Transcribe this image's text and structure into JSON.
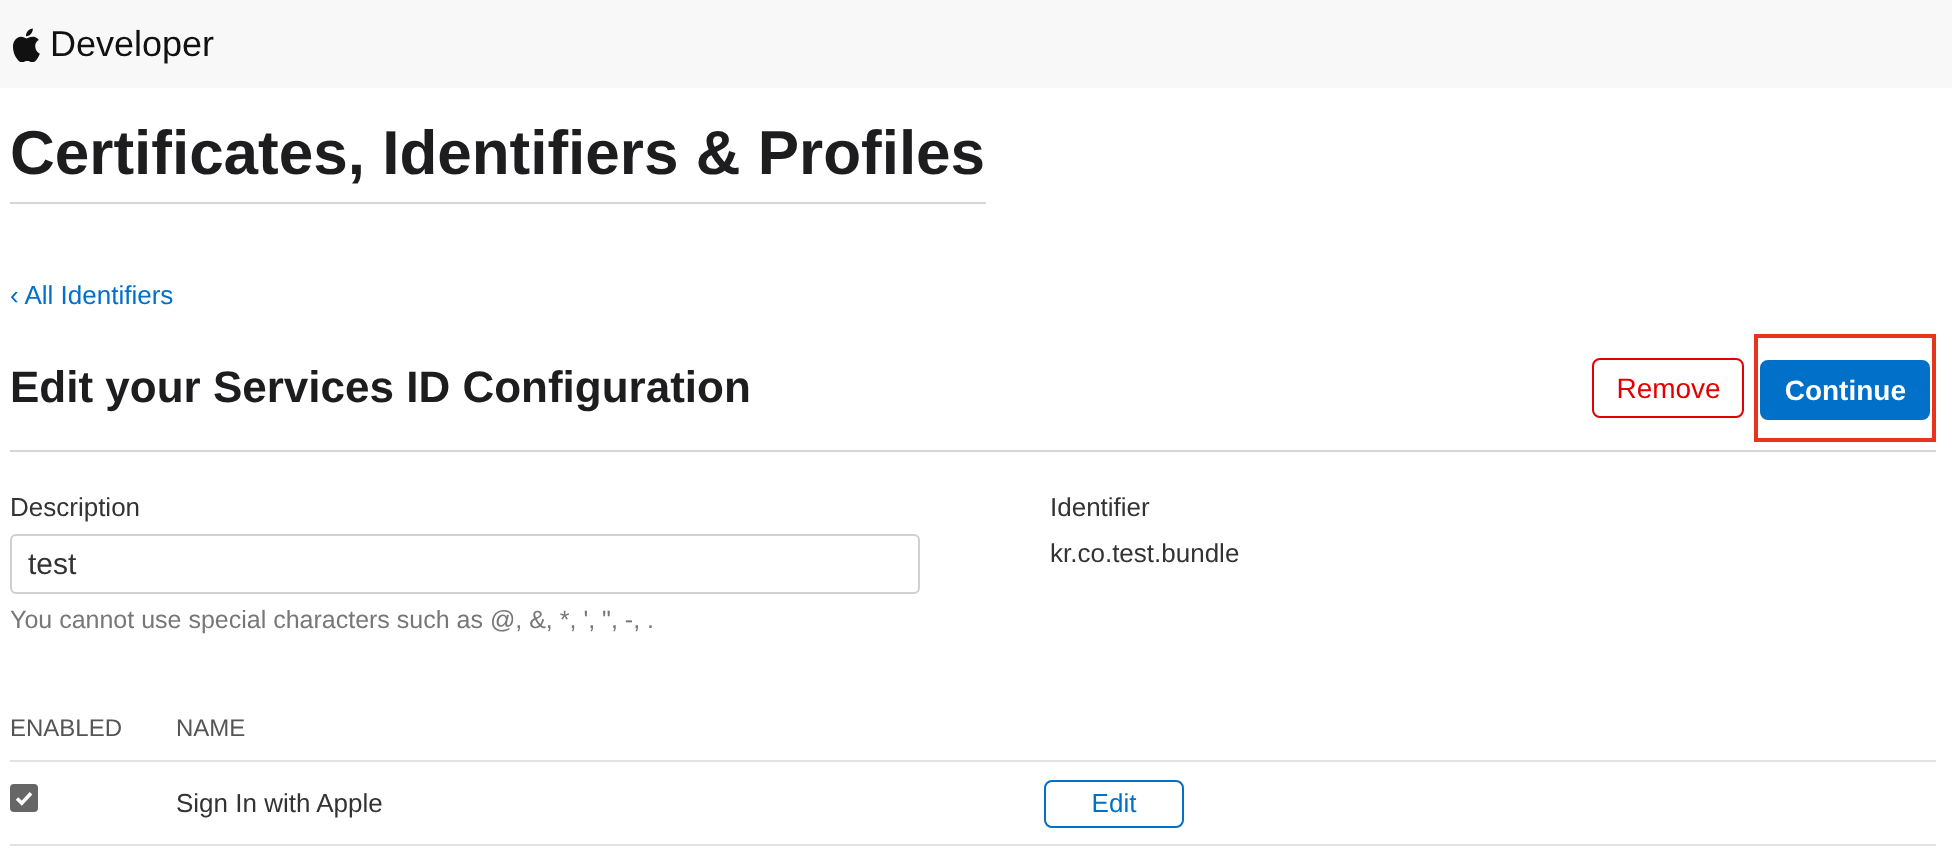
{
  "header": {
    "brand": "Developer"
  },
  "page_title": "Certificates, Identifiers & Profiles",
  "back_link": "‹ All Identifiers",
  "section_title": "Edit your Services ID Configuration",
  "buttons": [
    {
      "label": "Remove",
      "kind": "destructive",
      "highlighted": false
    },
    {
      "label": "Continue",
      "kind": "primary",
      "highlighted": true
    }
  ],
  "description": {
    "label": "Description",
    "value": "test",
    "hint": "You cannot use special characters such as @, &, *, ', \", -, ."
  },
  "identifier": {
    "label": "Identifier",
    "value": "kr.co.test.bundle"
  },
  "capabilities": {
    "columns": [
      "ENABLED",
      "NAME"
    ],
    "rows": [
      {
        "name": "Sign In with Apple",
        "checked": true,
        "action": "Edit"
      }
    ]
  }
}
